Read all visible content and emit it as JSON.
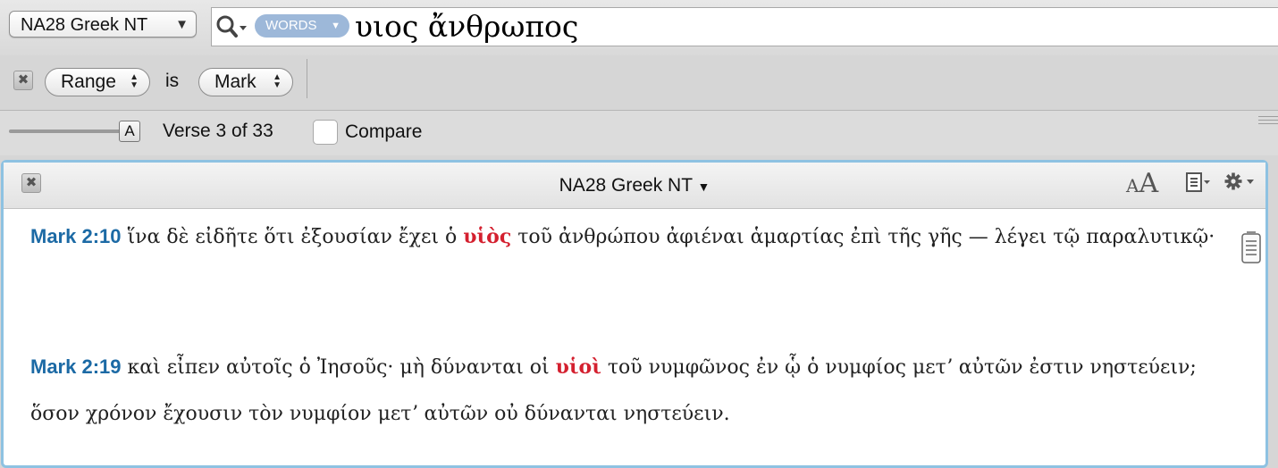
{
  "toolbar": {
    "resource_label": "NA28 Greek NT",
    "search_mode": "WORDS",
    "query": "υιος ἄνθρωπος"
  },
  "filter": {
    "field": "Range",
    "operator": "is",
    "value": "Mark"
  },
  "navigation": {
    "verse_label": "Verse 3 of 33",
    "slider_thumb_label": "A",
    "slider_position": 1.0,
    "compare_label": "Compare",
    "compare_checked": false
  },
  "pane": {
    "title": "NA28 Greek NT",
    "font_size_small": "A",
    "font_size_large": "A"
  },
  "results": [
    {
      "ref": "Mark 2:10",
      "before": "ἵνα δὲ εἰδῆτε ὅτι ἐξουσίαν ἔχει ὁ",
      "hit": "υἱὸς",
      "after": "τοῦ ἀνθρώπου ἀφιέναι ἁμαρτίας ἐπὶ τῆς γῆς — λέγει τῷ παραλυτικῷ·"
    },
    {
      "ref": "Mark 2:19",
      "before": "καὶ εἶπεν αὐτοῖς ὁ Ἰησοῦς· μὴ δύνανται οἱ",
      "hit": "υἱοὶ",
      "after": "τοῦ νυμφῶνος ἐν ᾧ ὁ νυμφίος μετʼ αὐτῶν ἐστιν νηστεύειν; ὅσον χρόνον ἔχουσιν τὸν νυμφίον μετʼ αὐτῶν οὐ δύνανται νηστεύειν."
    }
  ],
  "colors": {
    "reference": "#1c6aa5",
    "hit": "#d4202f",
    "pane_border": "#8ec2e2",
    "search_pill": "#9db8d9"
  },
  "icons": [
    "magnifier-icon",
    "chevron-down-icon",
    "close-icon",
    "stepper-arrows-icon",
    "font-size-icon",
    "layout-icon",
    "gear-icon",
    "scroll-icon"
  ]
}
